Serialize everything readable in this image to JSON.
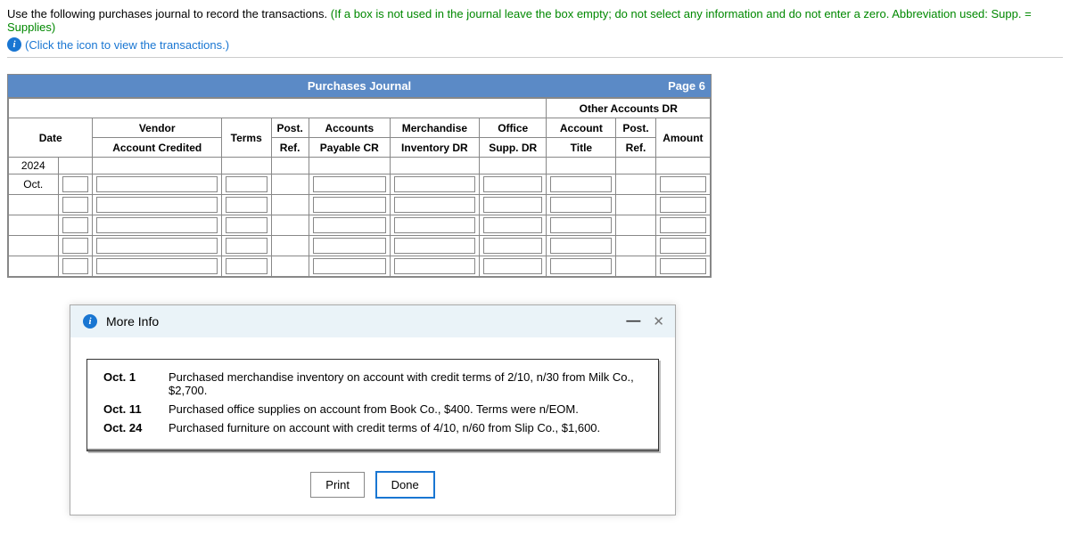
{
  "instructions": {
    "main": "Use the following purchases journal to record the transactions.",
    "parenthetical": "(If a box is not used in the journal leave the box empty; do not select any information and do not enter a zero. Abbreviation used: Supp. = Supplies)",
    "click_prompt": "(Click the icon to view the transactions.)"
  },
  "journal": {
    "title": "Purchases Journal",
    "page": "Page 6",
    "other_accounts": "Other Accounts DR",
    "headers": {
      "date": "Date",
      "vendor1": "Vendor",
      "vendor2": "Account Credited",
      "terms": "Terms",
      "post1": "Post.",
      "ref": "Ref.",
      "accounts": "Accounts",
      "payable": "Payable CR",
      "merch1": "Merchandise",
      "merch2": "Inventory DR",
      "office1": "Office",
      "office2": "Supp. DR",
      "acct1": "Account",
      "acct2": "Title",
      "post2": "Post.",
      "ref2": "Ref.",
      "amount": "Amount"
    },
    "year": "2024",
    "month": "Oct."
  },
  "more_info": {
    "title": "More Info",
    "rows": [
      {
        "date": "Oct. 1",
        "text": "Purchased merchandise inventory on account with credit terms of 2/10, n/30 from Milk Co., $2,700."
      },
      {
        "date": "Oct. 11",
        "text": "Purchased office supplies on account from Book Co., $400. Terms were n/EOM."
      },
      {
        "date": "Oct. 24",
        "text": "Purchased furniture on account with credit terms of 4/10, n/60 from Slip Co., $1,600."
      }
    ],
    "print": "Print",
    "done": "Done"
  }
}
